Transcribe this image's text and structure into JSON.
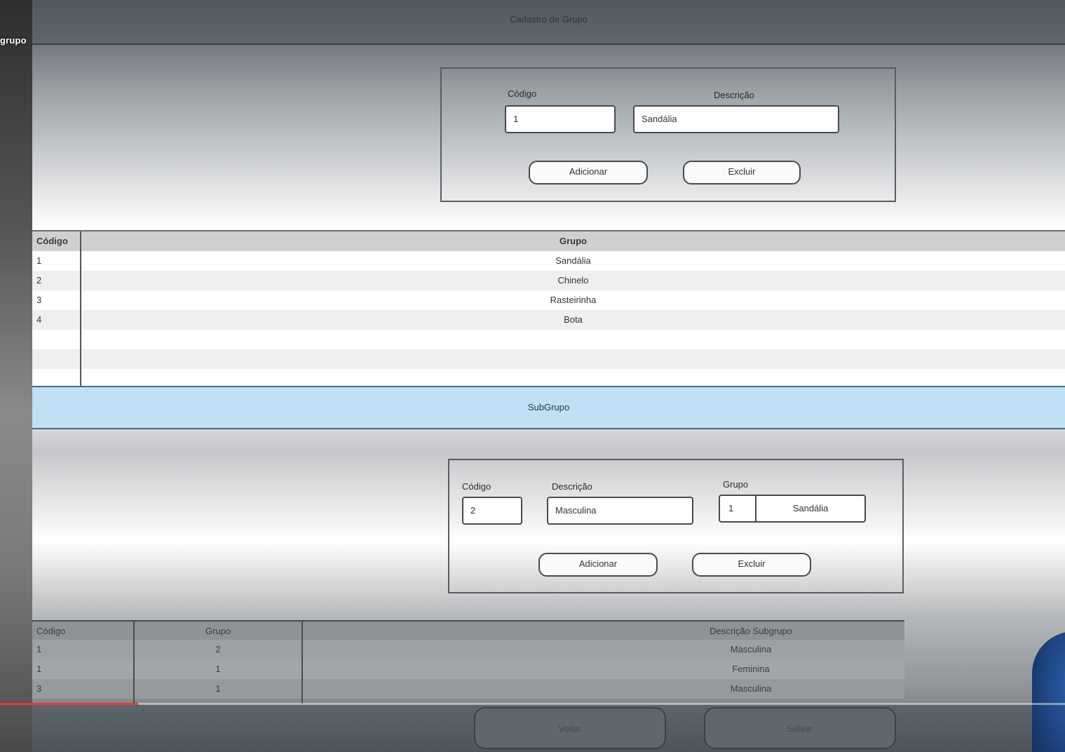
{
  "video": {
    "title": "grupo",
    "progress_percent": 13
  },
  "window": {
    "title": "Cadastro de Grupo"
  },
  "group_form": {
    "codigo_label": "Código",
    "descricao_label": "Descrição",
    "codigo_value": "1",
    "descricao_value": "Sandália",
    "add_label": "Adicionar",
    "delete_label": "Excluir"
  },
  "group_table": {
    "headers": [
      "Código",
      "Grupo"
    ],
    "rows": [
      {
        "codigo": "1",
        "grupo": "Sandália"
      },
      {
        "codigo": "2",
        "grupo": "Chinelo"
      },
      {
        "codigo": "3",
        "grupo": "Rasteirinha"
      },
      {
        "codigo": "4",
        "grupo": "Bota"
      }
    ]
  },
  "subgroup_section": {
    "title": "SubGrupo"
  },
  "subgroup_form": {
    "codigo_label": "Código",
    "descricao_label": "Descrição",
    "grupo_label": "Grupo",
    "codigo_value": "2",
    "descricao_value": "Masculina",
    "grupo_code": "1",
    "grupo_name": "Sandália",
    "add_label": "Adicionar",
    "delete_label": "Excluir"
  },
  "subgroup_table": {
    "headers": [
      "Código",
      "Grupo",
      "Descrição Subgrupo"
    ],
    "rows": [
      {
        "codigo": "1",
        "grupo": "2",
        "descricao": "Masculina"
      },
      {
        "codigo": "1",
        "grupo": "1",
        "descricao": "Feminina"
      },
      {
        "codigo": "3",
        "grupo": "1",
        "descricao": "Masculina"
      }
    ]
  },
  "footer": {
    "back_label": "Voltar",
    "save_label": "Salvar"
  }
}
